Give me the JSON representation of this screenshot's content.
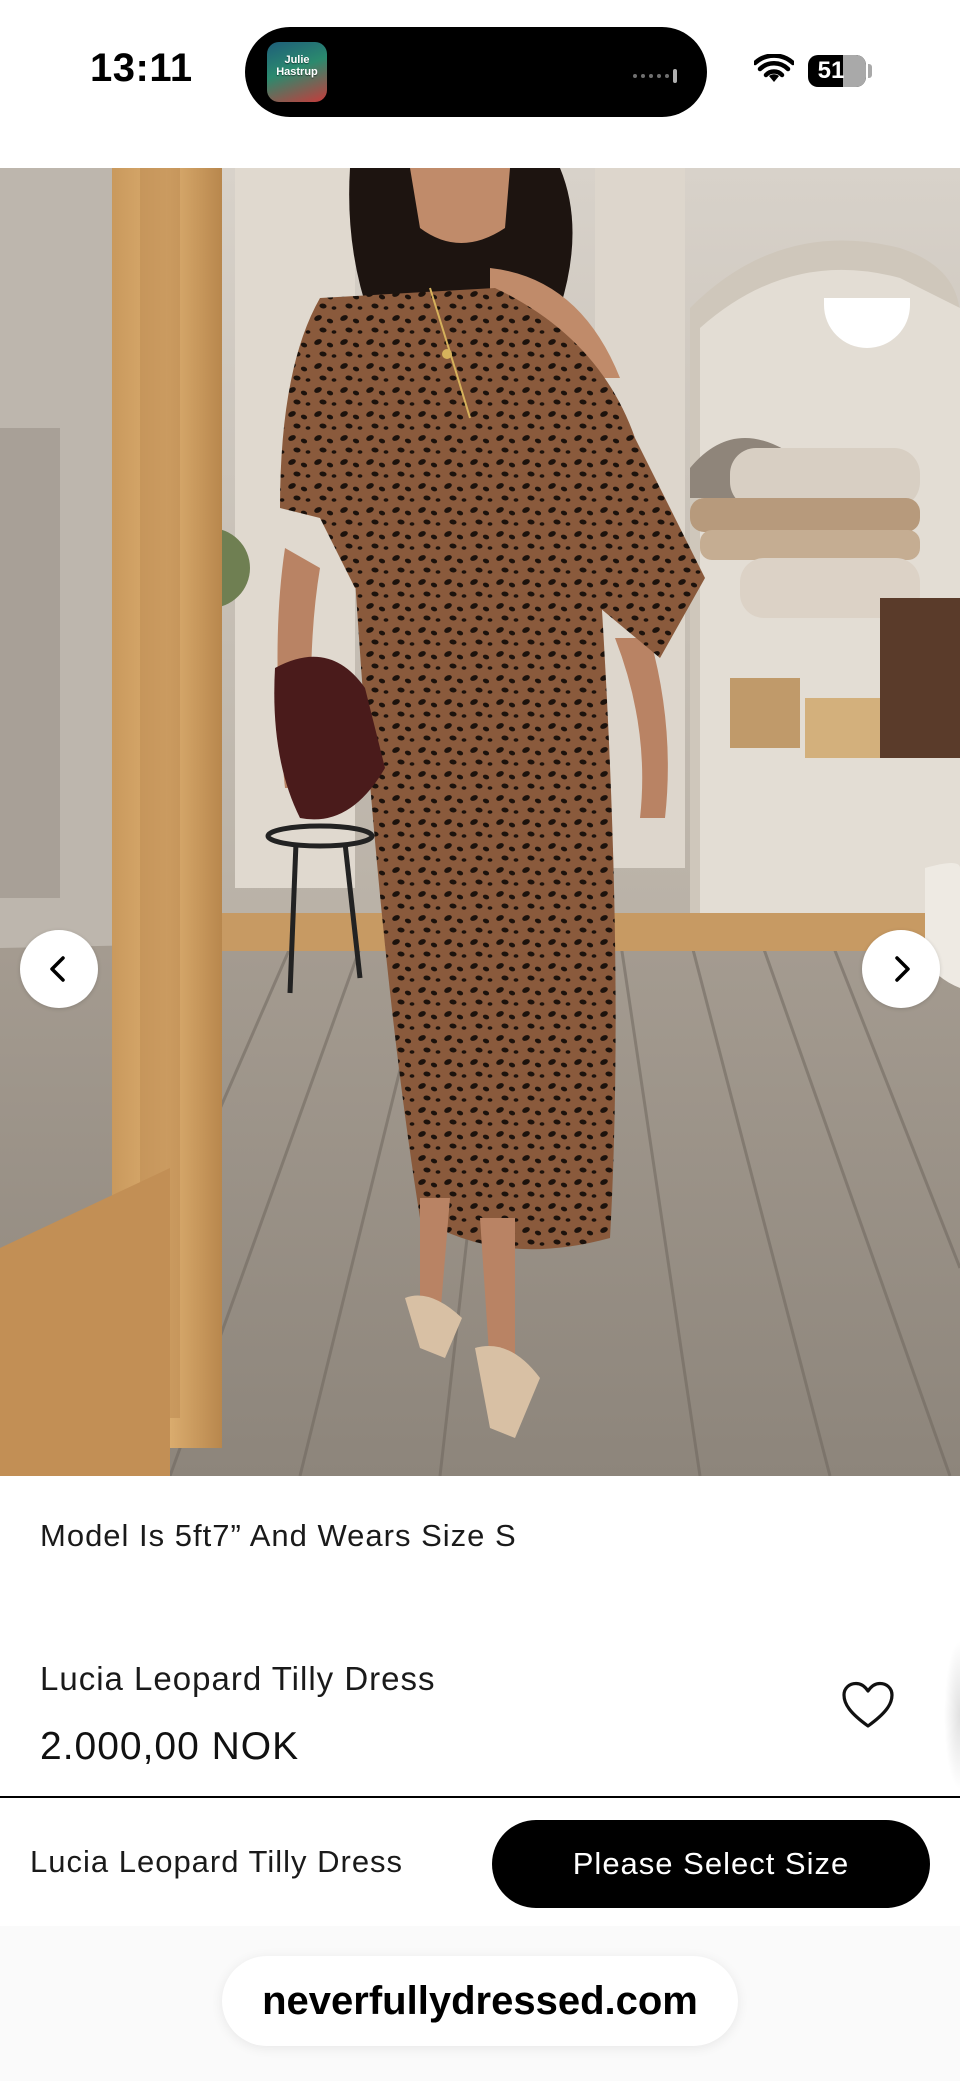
{
  "status_bar": {
    "time": "13:11",
    "battery_level": 51,
    "battery_text": "51",
    "now_playing_art_text": "Julie Hastrup",
    "wifi_icon": "wifi-icon"
  },
  "gallery": {
    "prev_icon": "chevron-left-icon",
    "next_icon": "chevron-right-icon"
  },
  "product": {
    "model_note": "Model Is 5ft7” And Wears Size S",
    "title": "Lucia Leopard Tilly Dress",
    "price": "2.000,00 NOK",
    "wishlist_icon": "heart-icon"
  },
  "sticky_bar": {
    "title": "Lucia Leopard Tilly Dress",
    "button_label": "Please Select Size"
  },
  "browser": {
    "url": "neverfullydressed.com"
  },
  "colors": {
    "primary": "#000000",
    "background": "#ffffff",
    "text": "#1a1a1a"
  }
}
